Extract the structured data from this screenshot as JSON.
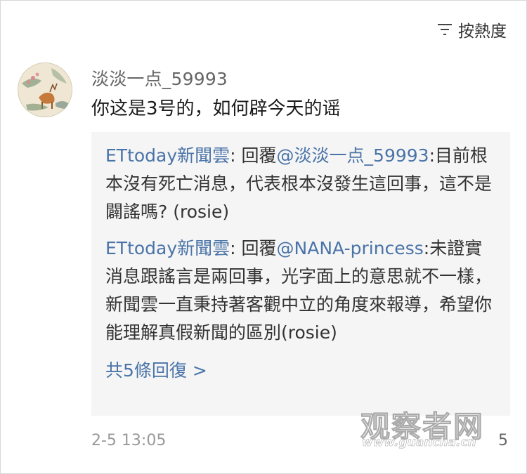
{
  "sort": {
    "icon": "sort-lines-icon",
    "label": "按熱度"
  },
  "comment": {
    "avatar": "deer-painting-avatar",
    "username": "淡淡一点_59993",
    "text": "你这是3号的，如何辟今天的谣",
    "time": "2-5 13:05",
    "like_count": "5"
  },
  "replies": [
    {
      "author": "ETtoday新聞雲",
      "sep": ": ",
      "prefix": "回覆",
      "mention": "@淡淡一点_59993",
      "colon": ":",
      "text": "目前根本沒有死亡消息，代表根本沒發生這回事，這不是闢謠嗎? (rosie)"
    },
    {
      "author": "ETtoday新聞雲",
      "sep": ": ",
      "prefix": "回覆",
      "mention": "@NANA-princess",
      "colon": ":",
      "text": "未證實消息跟謠言是兩回事，光字面上的意思就不一樣，新聞雲一直秉持著客觀中立的角度來報導，希望你能理解真假新聞的區別(rosie)"
    }
  ],
  "more_replies": "共5條回復 >",
  "watermark": {
    "main": "观察者网",
    "url": "www.guancha.cn"
  },
  "colors": {
    "link": "#4a74a8",
    "reply_bg": "#f5f5f5",
    "meta": "#999999"
  }
}
